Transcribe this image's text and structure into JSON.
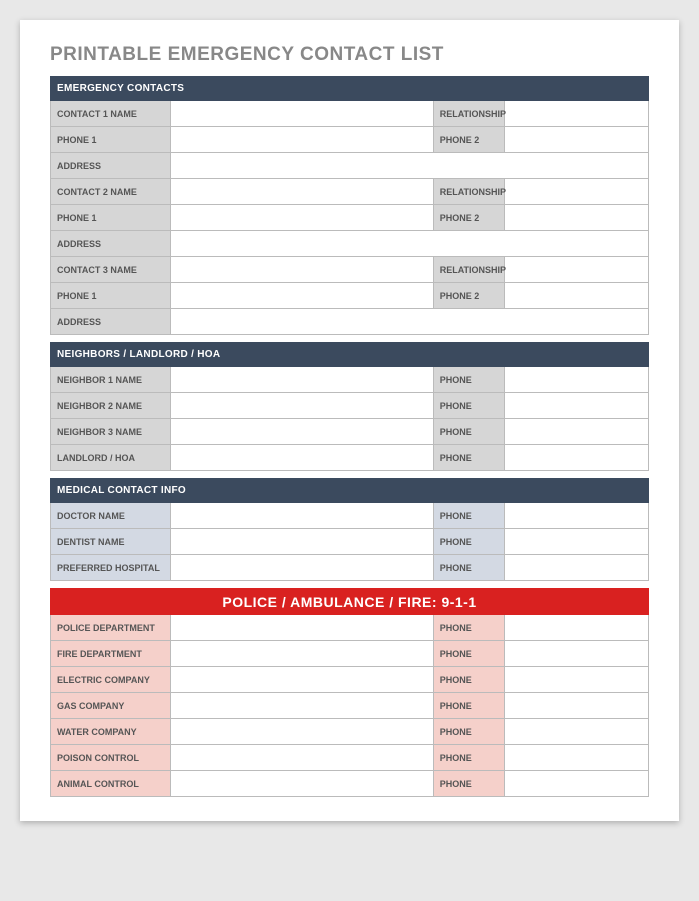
{
  "title": "PRINTABLE EMERGENCY CONTACT LIST",
  "sections": {
    "emergency": {
      "header": "EMERGENCY CONTACTS",
      "contacts": [
        {
          "name_label": "CONTACT 1 NAME",
          "relationship_label": "RELATIONSHIP",
          "phone1_label": "PHONE 1",
          "phone2_label": "PHONE 2",
          "address_label": "ADDRESS"
        },
        {
          "name_label": "CONTACT 2 NAME",
          "relationship_label": "RELATIONSHIP",
          "phone1_label": "PHONE 1",
          "phone2_label": "PHONE 2",
          "address_label": "ADDRESS"
        },
        {
          "name_label": "CONTACT 3 NAME",
          "relationship_label": "RELATIONSHIP",
          "phone1_label": "PHONE 1",
          "phone2_label": "PHONE 2",
          "address_label": "ADDRESS"
        }
      ]
    },
    "neighbors": {
      "header": "NEIGHBORS / LANDLORD / HOA",
      "rows": [
        {
          "label": "NEIGHBOR 1 NAME",
          "phone_label": "PHONE"
        },
        {
          "label": "NEIGHBOR 2 NAME",
          "phone_label": "PHONE"
        },
        {
          "label": "NEIGHBOR 3 NAME",
          "phone_label": "PHONE"
        },
        {
          "label": "LANDLORD / HOA",
          "phone_label": "PHONE"
        }
      ]
    },
    "medical": {
      "header": "MEDICAL CONTACT INFO",
      "rows": [
        {
          "label": "DOCTOR NAME",
          "phone_label": "PHONE"
        },
        {
          "label": "DENTIST NAME",
          "phone_label": "PHONE"
        },
        {
          "label": "PREFERRED HOSPITAL",
          "phone_label": "PHONE"
        }
      ]
    },
    "emergency911": {
      "header": "POLICE / AMBULANCE / FIRE:  9-1-1",
      "rows": [
        {
          "label": "POLICE DEPARTMENT",
          "phone_label": "PHONE"
        },
        {
          "label": "FIRE DEPARTMENT",
          "phone_label": "PHONE"
        },
        {
          "label": "ELECTRIC COMPANY",
          "phone_label": "PHONE"
        },
        {
          "label": "GAS COMPANY",
          "phone_label": "PHONE"
        },
        {
          "label": "WATER COMPANY",
          "phone_label": "PHONE"
        },
        {
          "label": "POISON CONTROL",
          "phone_label": "PHONE"
        },
        {
          "label": "ANIMAL CONTROL",
          "phone_label": "PHONE"
        }
      ]
    }
  }
}
